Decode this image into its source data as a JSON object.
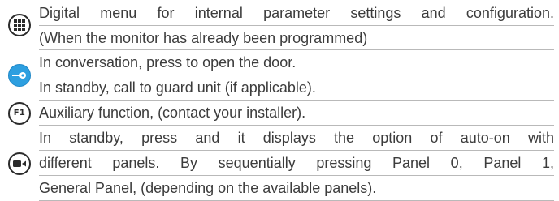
{
  "rows": [
    {
      "icon": "grid-menu-icon",
      "lines": [
        "Digital menu for internal parameter settings and configuration.",
        "(When the monitor has already been programmed)"
      ]
    },
    {
      "icon": "key-door-icon",
      "lines": [
        "In conversation, press to open the door.",
        "In standby, call to guard unit (if applicable)."
      ]
    },
    {
      "icon": "f1-icon",
      "icon_text": "F1",
      "lines": [
        "Auxiliary function, (contact your installer)."
      ]
    },
    {
      "icon": "camera-autoon-icon",
      "lines": [
        "In standby, press and it displays the option of auto-on with",
        "different panels. By sequentially pressing Panel 0, Panel 1,",
        "General Panel, (depending on the available panels)."
      ]
    }
  ],
  "colors": {
    "accent": "#2d9fe0",
    "text": "#3c3c3c",
    "divider": "#b9b9b9"
  }
}
